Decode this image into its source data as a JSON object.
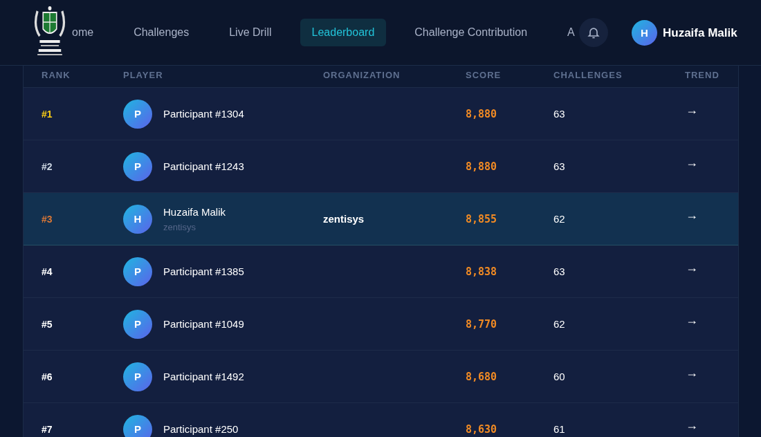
{
  "nav": {
    "items": [
      {
        "label": "ome",
        "selected": false
      },
      {
        "label": "Challenges",
        "selected": false
      },
      {
        "label": "Live Drill",
        "selected": false
      },
      {
        "label": "Leaderboard",
        "selected": true
      },
      {
        "label": "Challenge Contribution",
        "selected": false
      },
      {
        "label": "A",
        "selected": false
      }
    ],
    "user": {
      "initial": "H",
      "name": "Huzaifa Malik"
    }
  },
  "table": {
    "columns": [
      "RANK",
      "PLAYER",
      "ORGANIZATION",
      "SCORE",
      "CHALLENGES",
      "TREND"
    ],
    "rows": [
      {
        "rank": "#1",
        "color": "#facc15",
        "initial": "P",
        "name": "Participant #1304",
        "score": "8,880",
        "challenges": "63",
        "trend": "→",
        "highlighted": false
      },
      {
        "rank": "#2",
        "color": "#cbd5e1",
        "initial": "P",
        "name": "Participant #1243",
        "score": "8,880",
        "challenges": "63",
        "trend": "→",
        "highlighted": false
      },
      {
        "rank": "#3",
        "color": "#d97736",
        "initial": "H",
        "name": "Huzaifa Malik",
        "subtitle": "zentisys",
        "organization": "zentisys",
        "score": "8,855",
        "challenges": "62",
        "trend": "→",
        "highlighted": true
      },
      {
        "rank": "#4",
        "color": "#ffffff",
        "initial": "P",
        "name": "Participant #1385",
        "score": "8,838",
        "challenges": "63",
        "trend": "→",
        "highlighted": false
      },
      {
        "rank": "#5",
        "color": "#ffffff",
        "initial": "P",
        "name": "Participant #1049",
        "score": "8,770",
        "challenges": "62",
        "trend": "→",
        "highlighted": false
      },
      {
        "rank": "#6",
        "color": "#ffffff",
        "initial": "P",
        "name": "Participant #1492",
        "score": "8,680",
        "challenges": "60",
        "trend": "→",
        "highlighted": false
      },
      {
        "rank": "#7",
        "color": "#ffffff",
        "initial": "P",
        "name": "Participant #250",
        "score": "8,630",
        "challenges": "61",
        "trend": "→",
        "highlighted": false
      }
    ]
  }
}
